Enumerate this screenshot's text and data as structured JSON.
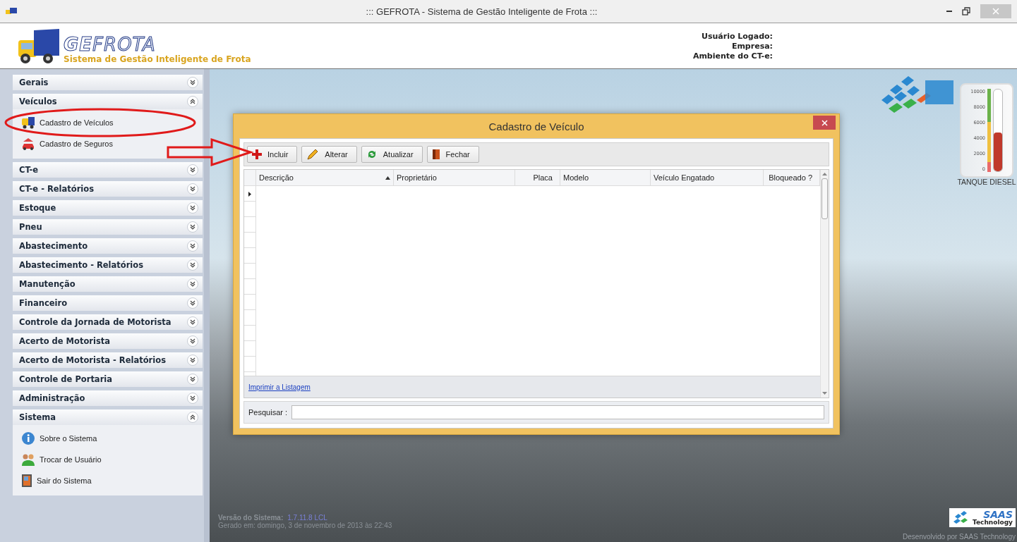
{
  "window": {
    "title": "::: GEFROTA - Sistema de Gestão Inteligente de Frota :::"
  },
  "header": {
    "logo": "**GE**FROTA",
    "subtitle": "Sistema de Gestão Inteligente de Frota",
    "user_labels": [
      "Usuário Logado:",
      "Empresa:",
      "Ambiente do CT-e:"
    ]
  },
  "sidebar": {
    "groups": [
      {
        "label": "Gerais",
        "expanded": false
      },
      {
        "label": "Veículos",
        "expanded": true,
        "items": [
          "Cadastro de Veículos",
          "Cadastro de Seguros"
        ]
      },
      {
        "label": "CT-e",
        "expanded": false
      },
      {
        "label": "CT-e - Relatórios",
        "expanded": false
      },
      {
        "label": "Estoque",
        "expanded": false
      },
      {
        "label": "Pneu",
        "expanded": false
      },
      {
        "label": "Abastecimento",
        "expanded": false
      },
      {
        "label": "Abastecimento - Relatórios",
        "expanded": false
      },
      {
        "label": "Manutenção",
        "expanded": false
      },
      {
        "label": "Financeiro",
        "expanded": false
      },
      {
        "label": "Controle da Jornada de Motorista",
        "expanded": false
      },
      {
        "label": "Acerto de Motorista",
        "expanded": false
      },
      {
        "label": "Acerto de Motorista - Relatórios",
        "expanded": false
      },
      {
        "label": "Controle de Portaria",
        "expanded": false
      },
      {
        "label": "Administração",
        "expanded": false
      },
      {
        "label": "Sistema",
        "expanded": true,
        "items": [
          "Sobre o Sistema",
          "Trocar de Usuário",
          "Sair do Sistema"
        ]
      }
    ]
  },
  "dialog": {
    "title": "Cadastro de Veículo",
    "toolbar": [
      {
        "label": "Incluir",
        "kind": "add"
      },
      {
        "label": "Alterar",
        "kind": "edit"
      },
      {
        "label": "Atualizar",
        "kind": "refresh"
      },
      {
        "label": "Fechar",
        "kind": "close"
      }
    ],
    "table": {
      "columns": [
        {
          "label": "Descrição",
          "sorted": true
        },
        {
          "label": "Proprietário",
          "sorted": false
        },
        {
          "label": "Placa",
          "sorted": false
        },
        {
          "label": "Modelo",
          "sorted": false
        },
        {
          "label": "Veículo Engatado",
          "sorted": false
        },
        {
          "label": "Bloqueado ?",
          "sorted": false
        }
      ]
    },
    "print_link": "Imprimir a Listagem",
    "search": {
      "label": "Pesquisar :"
    }
  },
  "gauge": {
    "ticks": [
      "10000",
      "8000",
      "6000",
      "4000",
      "2000",
      "0"
    ],
    "level": 0.47,
    "label": "TANQUE DIESEL"
  },
  "footer": {
    "version_label": "Versão do Sistema:",
    "version": "1.7.11.8 LCL",
    "generated": "Gerado em: domingo, 3 de novembro de 2013 às 22:43",
    "credit": "Desenvolvido por SAAS Technology",
    "logo_top": "SAAS",
    "logo_bottom": "Technology"
  }
}
